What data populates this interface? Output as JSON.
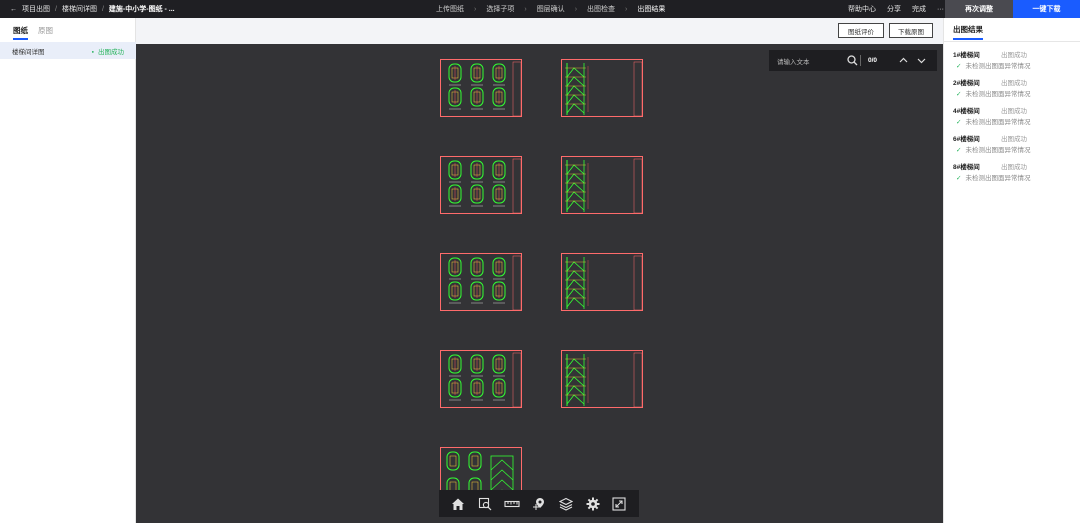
{
  "topbar": {
    "back_icon": "arrow-left-icon",
    "breadcrumbs": [
      "项目出图",
      "楼梯间详图",
      "建施-中小学-图纸 - ..."
    ],
    "steps": [
      "上传图纸",
      "选择子项",
      "图层确认",
      "出图检查",
      "出图结果"
    ],
    "active_step": 4,
    "help": "帮助中心",
    "share": "分享",
    "done": "完成",
    "more": "···",
    "adjust": "再次调整",
    "download_all": "一键下载"
  },
  "left": {
    "tabs": [
      "图纸",
      "原图"
    ],
    "active_tab": 0,
    "items": [
      {
        "name": "楼梯间详图",
        "status": "出图成功"
      }
    ]
  },
  "toolbar": {
    "evaluate": "图纸评价",
    "download_original": "下载原图"
  },
  "search": {
    "placeholder": "请输入文本",
    "count": "0/0"
  },
  "bottom_tools": [
    "home-icon",
    "zoom-window-icon",
    "measure-ruler-icon",
    "location-pin-icon",
    "layers-icon",
    "settings-gear-icon",
    "fullscreen-icon"
  ],
  "results": {
    "title": "出图结果",
    "items": [
      {
        "name": "1#楼梯间",
        "status": "出图成功",
        "detail": "未检测出图面异常情况"
      },
      {
        "name": "2#楼梯间",
        "status": "出图成功",
        "detail": "未检测出图面异常情况"
      },
      {
        "name": "4#楼梯间",
        "status": "出图成功",
        "detail": "未检测出图面异常情况"
      },
      {
        "name": "6#楼梯间",
        "status": "出图成功",
        "detail": "未检测出图面异常情况"
      },
      {
        "name": "8#楼梯间",
        "status": "出图成功",
        "detail": "未检测出图面异常情况"
      }
    ]
  },
  "colors": {
    "accent": "#1a5cff",
    "success": "#25b35b",
    "canvas": "#333336",
    "sheet_border": "#ff6b6b",
    "cad_line": "#33ff33"
  }
}
